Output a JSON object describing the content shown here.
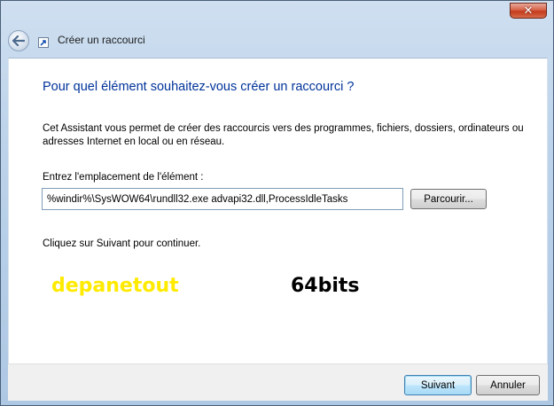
{
  "window": {
    "title": "Créer un raccourci",
    "close_symbol": "✕"
  },
  "icons": {
    "back": "back-arrow-icon",
    "wizard": "shortcut-wizard-icon",
    "close": "close-icon"
  },
  "content": {
    "heading": "Pour quel élément souhaitez-vous créer un raccourci ?",
    "description": "Cet Assistant vous permet de créer des raccourcis vers des programmes, fichiers, dossiers, ordinateurs ou adresses Internet en local ou en réseau.",
    "location_label": "Entrez l'emplacement de l'élément :",
    "location_value": "%windir%\\SysWOW64\\rundll32.exe advapi32.dll,ProcessIdleTasks",
    "browse_label": "Parcourir...",
    "continue_text": "Cliquez sur Suivant pour continuer."
  },
  "watermark": {
    "left": "depanetout",
    "right": "64bits",
    "left_color": "#ffea00",
    "right_color": "#000000"
  },
  "footer": {
    "next_label": "Suivant",
    "cancel_label": "Annuler"
  },
  "colors": {
    "heading": "#003399",
    "close_button": "#c33b1c"
  }
}
